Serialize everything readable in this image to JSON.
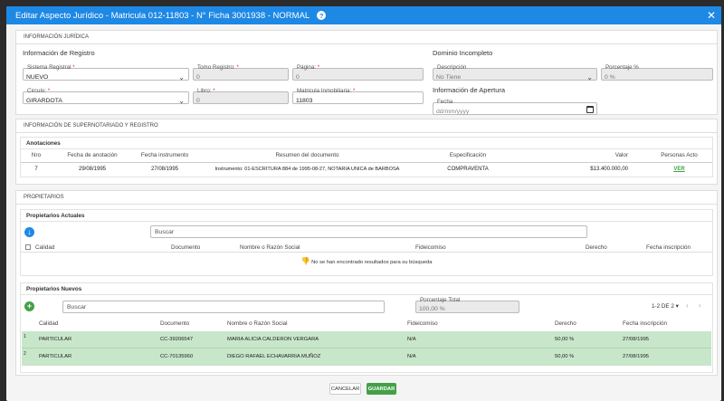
{
  "window": {
    "title": "Editar Aspecto Jurídico - Matricula 012-11803 - N° Ficha 3001938 - NORMAL",
    "help_icon": "question-circle-icon",
    "close_icon": "close-icon"
  },
  "juridica": {
    "header": "INFORMACIÓN JURÍDICA",
    "registro_title": "Información de Registro",
    "sistema_registral": {
      "label": "Sistema Registral",
      "value": "NUEVO"
    },
    "tomo_registro": {
      "label": "Tomo Registro:",
      "value": "0"
    },
    "pagina": {
      "label": "Página:",
      "value": "0"
    },
    "circulo": {
      "label": "Circulo:",
      "value": "GIRARDOTA"
    },
    "libro": {
      "label": "Libro:",
      "value": "0"
    },
    "matricula": {
      "label": "Matricula Inmobiliaria:",
      "value": "11803"
    },
    "dominio_title": "Dominio Incompleto",
    "descripcion": {
      "label": "Descripción",
      "value": "No Tiene"
    },
    "porcentaje": {
      "label": "Porcentaje %",
      "value": "0 %"
    },
    "apertura_title": "Información de Apertura",
    "fecha": {
      "label": "Fecha",
      "placeholder": "dd/mm/yyyy"
    }
  },
  "supernotariado": {
    "header": "INFORMACIÓN DE SUPERNOTARIADO Y REGISTRO",
    "anotaciones_title": "Anotaciones",
    "columns": [
      "Nro",
      "Fecha de anotación",
      "Fecha instrumento",
      "Resumen del documento",
      "Especificación",
      "Valor",
      "Personas Acto"
    ],
    "rows": [
      {
        "nro": "7",
        "fecha_anotacion": "29/08/1995",
        "fecha_instrumento": "27/08/1995",
        "resumen": "Instrumento: 01-ESCRITURA 884 de 1995-08-27, NOTARIA UNICA de BARBOSA",
        "especificacion": "COMPRAVENTA",
        "valor": "$13.400.000,00",
        "personas": "VER"
      }
    ]
  },
  "propietarios": {
    "header": "PROPIETARIOS",
    "actuales": {
      "title": "Propietarios Actuales",
      "search_placeholder": "Buscar",
      "columns": [
        "Calidad",
        "Documento",
        "Nombre o Razón Social",
        "Fideicomiso",
        "Derecho",
        "Fecha inscripción"
      ],
      "empty_message": "No se han encontrado resultados para su búsqueda"
    },
    "nuevos": {
      "title": "Propietarios Nuevos",
      "search_placeholder": "Buscar",
      "porcentaje_total": {
        "label": "Porcentaje Total",
        "value": "100,00 %"
      },
      "pagination": "1-2 DE 2",
      "columns": [
        "Calidad",
        "Documento",
        "Nombre o Razón Social",
        "Fideicomiso",
        "Derecho",
        "Fecha inscripción"
      ],
      "rows": [
        {
          "nro": "1",
          "calidad": "PARTICULAR",
          "documento": "CC-39206547",
          "nombre": "MARIA ALICIA CALDERON VERGARA",
          "fideicomiso": "N/A",
          "derecho": "50,00 %",
          "fecha": "27/08/1995"
        },
        {
          "nro": "2",
          "calidad": "PARTICULAR",
          "documento": "CC-70135960",
          "nombre": "DIEGO RAFAEL ECHAVARRIA MUÑOZ",
          "fideicomiso": "N/A",
          "derecho": "50,00 %",
          "fecha": "27/08/1995"
        }
      ]
    }
  },
  "footer": {
    "cancel_label": "CANCELAR",
    "save_label": "GUARDAR"
  },
  "colors": {
    "primary": "#1e88e5",
    "success": "#43a047",
    "row_highlight": "#c8e6c9"
  }
}
